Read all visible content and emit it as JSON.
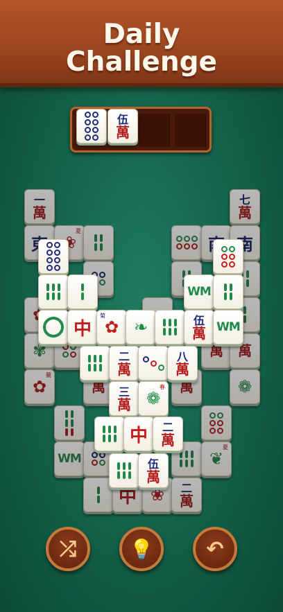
{
  "header": {
    "line1": "Daily",
    "line2": "Challenge"
  },
  "tray": {
    "tiles": [
      {
        "kind": "circles",
        "count": 8
      },
      {
        "kind": "wan",
        "top": "伍",
        "bottom": "萬"
      }
    ],
    "capacity": 4
  },
  "tiles_text": {
    "yi": "一",
    "wan": "萬",
    "qi": "七",
    "dong": "東",
    "nan": "南",
    "zhong": "中",
    "wu": "伍",
    "er": "二",
    "san": "三",
    "ba": "八",
    "xia": "夏",
    "chun": "春",
    "ju": "菊",
    "lan": "蘭"
  },
  "controls": {
    "shuffle_icon": "shuffle-icon",
    "hint_icon": "lightbulb-icon",
    "undo_icon": "undo-icon"
  },
  "colors": {
    "header": "#9c4620",
    "felt": "#146049",
    "tray_border": "#b4652c",
    "tile": "#f4efe2"
  }
}
